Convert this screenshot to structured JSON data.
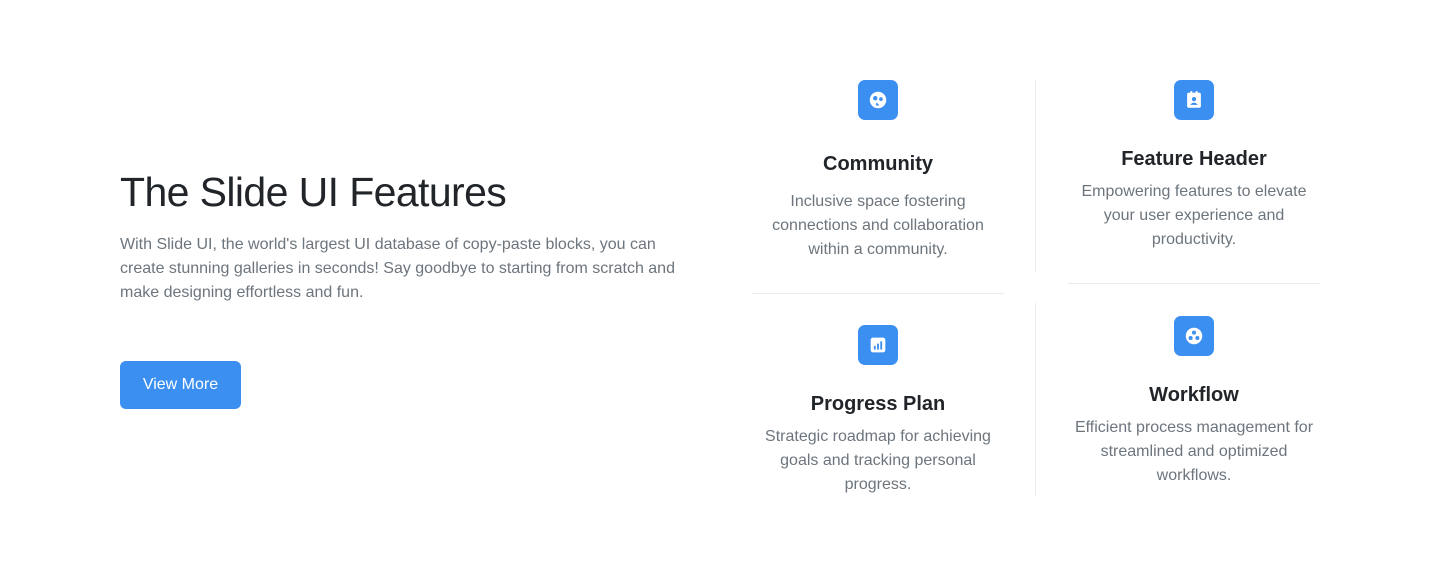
{
  "hero": {
    "title": "The Slide UI Features",
    "description": "With Slide UI, the world's largest UI database of copy-paste blocks, you can create stunning galleries in seconds! Say goodbye to starting from scratch and make designing effortless and fun.",
    "button_label": "View More"
  },
  "features": [
    {
      "title": "Community",
      "description": "Inclusive space fostering connections and collaboration within a community.",
      "icon": "community-icon"
    },
    {
      "title": "Feature Header",
      "description": "Empowering features to elevate your user experience and productivity.",
      "icon": "contact-card-icon"
    },
    {
      "title": "Progress Plan",
      "description": "Strategic roadmap for achieving goals and tracking personal progress.",
      "icon": "chart-icon"
    },
    {
      "title": "Workflow",
      "description": "Efficient process management for streamlined and optimized workflows.",
      "icon": "workflow-icon"
    }
  ],
  "colors": {
    "accent": "#3b8ff0",
    "heading": "#212529",
    "body_text": "#6c757d",
    "divider": "#e9ecef"
  }
}
